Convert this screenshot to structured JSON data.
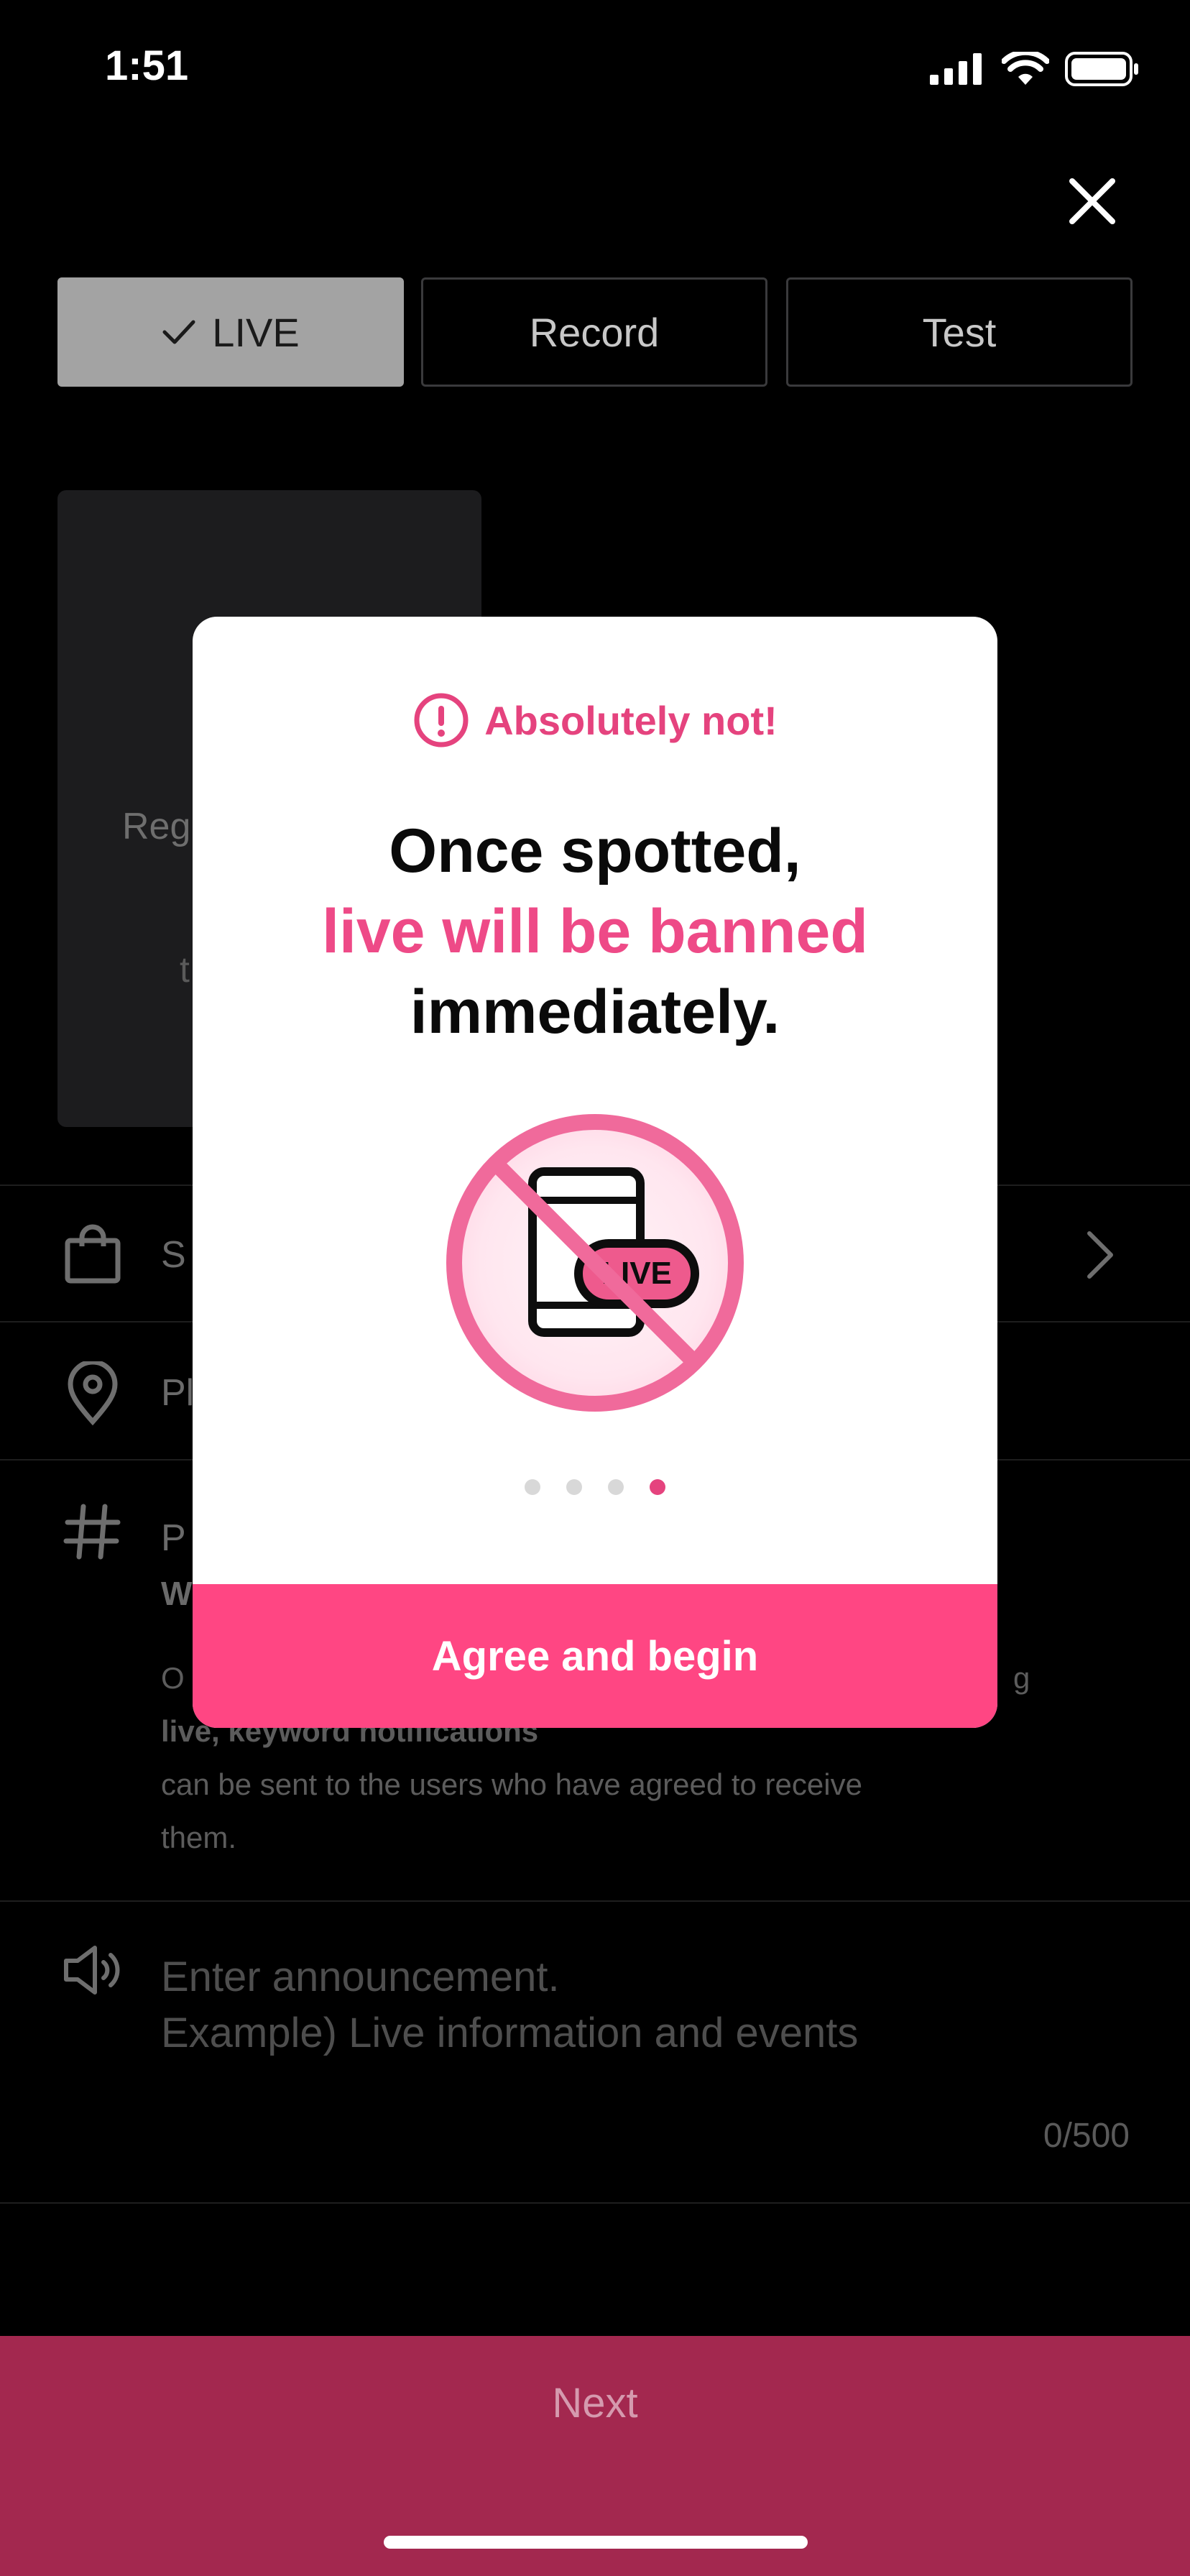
{
  "status_bar": {
    "time": "1:51"
  },
  "mode_tabs": [
    {
      "label": "LIVE",
      "selected": true
    },
    {
      "label": "Record",
      "selected": false
    },
    {
      "label": "Test",
      "selected": false
    }
  ],
  "background": {
    "thumbnail_text_1": "Reg",
    "thumbnail_text_2": "t",
    "shop_row_label": "S",
    "place_row_label": "Pl",
    "hashtag_row_label": "P",
    "hashtag_row_label_2": "W",
    "hint_line_1": "O",
    "hint_line_1_end": "g",
    "hint_line_2": "live, keyword notifications",
    "hint_line_3": "can be sent to the users who have agreed to receive",
    "hint_line_4": "them.",
    "announcement_placeholder_1": "Enter announcement.",
    "announcement_placeholder_2": "Example) Live information and events",
    "announcement_counter": "0/500",
    "next_label": "Next"
  },
  "modal": {
    "warning_label": "Absolutely not!",
    "headline_line_1": "Once spotted,",
    "headline_line_2": "live will be banned",
    "headline_line_3": "immediately.",
    "illustration_badge": "LIVE",
    "page_dots": {
      "count": 4,
      "active_index": 3
    },
    "agree_button": "Agree and begin"
  },
  "colors": {
    "accent": "#ff4683",
    "accent_text": "#ee4a87",
    "next_bar": "#a3284f"
  }
}
